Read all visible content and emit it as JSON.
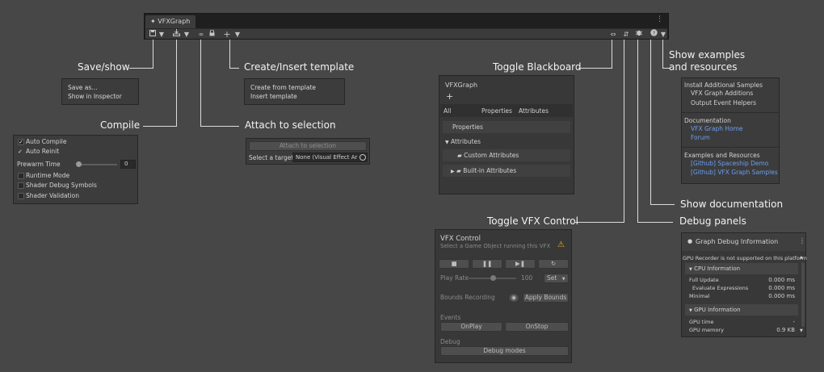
{
  "toolbar": {
    "tab_label": "VFXGraph",
    "tabbar_menu_glyph": "⋮",
    "icons": {
      "save": "save-icon",
      "save_dropdown": "chevron-down-icon",
      "compile": "compile-icon",
      "compile_dropdown": "chevron-down-icon",
      "attach": "link-icon",
      "lock": "lock-icon",
      "add": "plus-icon",
      "add_dropdown": "chevron-down-icon",
      "blackboard": "blackboard-icon",
      "vfx_control": "vfx-control-icon",
      "debug": "bug-icon",
      "help": "help-icon",
      "help_dropdown": "chevron-down-icon"
    }
  },
  "callouts": {
    "save_show": "Save/show",
    "compile": "Compile",
    "create_insert": "Create/Insert template",
    "attach": "Attach to selection",
    "toggle_blackboard": "Toggle Blackboard",
    "toggle_vfx_control": "Toggle VFX Control",
    "examples_line1": "Show examples",
    "examples_line2": "and resources",
    "show_documentation": "Show documentation",
    "debug_panels": "Debug panels"
  },
  "save_menu": {
    "items": [
      "Save as...",
      "Show in Inspector"
    ]
  },
  "compile_menu": {
    "auto_compile": {
      "label": "Auto Compile",
      "checked": true
    },
    "auto_reinit": {
      "label": "Auto Reinit",
      "checked": true
    },
    "prewarm": {
      "label": "Prewarm Time",
      "value": "0",
      "fraction": 0.0
    },
    "runtime_mode": {
      "label": "Runtime Mode",
      "checked": false
    },
    "shader_debug": {
      "label": "Shader Debug Symbols",
      "checked": false
    },
    "shader_validation": {
      "label": "Shader Validation",
      "checked": false
    }
  },
  "template_menu": {
    "items": [
      "Create from template",
      "Insert template"
    ]
  },
  "attach_panel": {
    "button": "Attach to selection",
    "target_label": "Select a target",
    "target_value": "None (Visual Effect Ar"
  },
  "blackboard": {
    "title": "VFXGraph",
    "add": "+",
    "tabs": [
      "All",
      "Properties",
      "Attributes"
    ],
    "properties": "Properties",
    "attributes": "Attributes",
    "custom": "Custom Attributes",
    "builtin": "Built-in Attributes"
  },
  "vfx_control": {
    "title": "VFX Control",
    "subtitle": "Select a Game Object running this VFX",
    "warning": "⚠",
    "play_rate_label": "Play Rate",
    "play_rate_value": "100",
    "play_rate_fraction": 0.5,
    "set_label": "Set",
    "bounds_label": "Bounds Recording",
    "apply_bounds": "Apply Bounds",
    "events_label": "Events",
    "on_play": "OnPlay",
    "on_stop": "OnStop",
    "debug_label": "Debug",
    "debug_modes": "Debug modes"
  },
  "help_menu": {
    "install_header": "Install Additional Samples",
    "install_items": [
      "VFX Graph Additions",
      "Output Event Helpers"
    ],
    "doc_header": "Documentation",
    "doc_items": [
      "VFX Graph Home",
      "Forum"
    ],
    "examples_header": "Examples and Resources",
    "examples_items": [
      "[Github] Spaceship Demo",
      "[Github] VFX Graph Samples"
    ]
  },
  "debug_panel": {
    "title": "Graph Debug Information",
    "gpu_note": "GPU Recorder is not supported on this platform",
    "cpu_header": "CPU Information",
    "cpu_rows": [
      {
        "label": "Full Update",
        "value": "0.000 ms"
      },
      {
        "label": "Evaluate Expressions",
        "value": "0.000 ms"
      },
      {
        "label": "Minimal",
        "value": "0.000 ms"
      }
    ],
    "gpu_header": "GPU Information",
    "gpu_rows": [
      {
        "label": "GPU time",
        "value": "-"
      },
      {
        "label": "GPU memory",
        "value": "0.9 KB"
      }
    ]
  },
  "colors": {
    "background": "#474747",
    "toolbar": "#1f1f1f",
    "panel": "#3c3c3c",
    "link": "#6c9ef0",
    "warning": "#e8b31c"
  }
}
